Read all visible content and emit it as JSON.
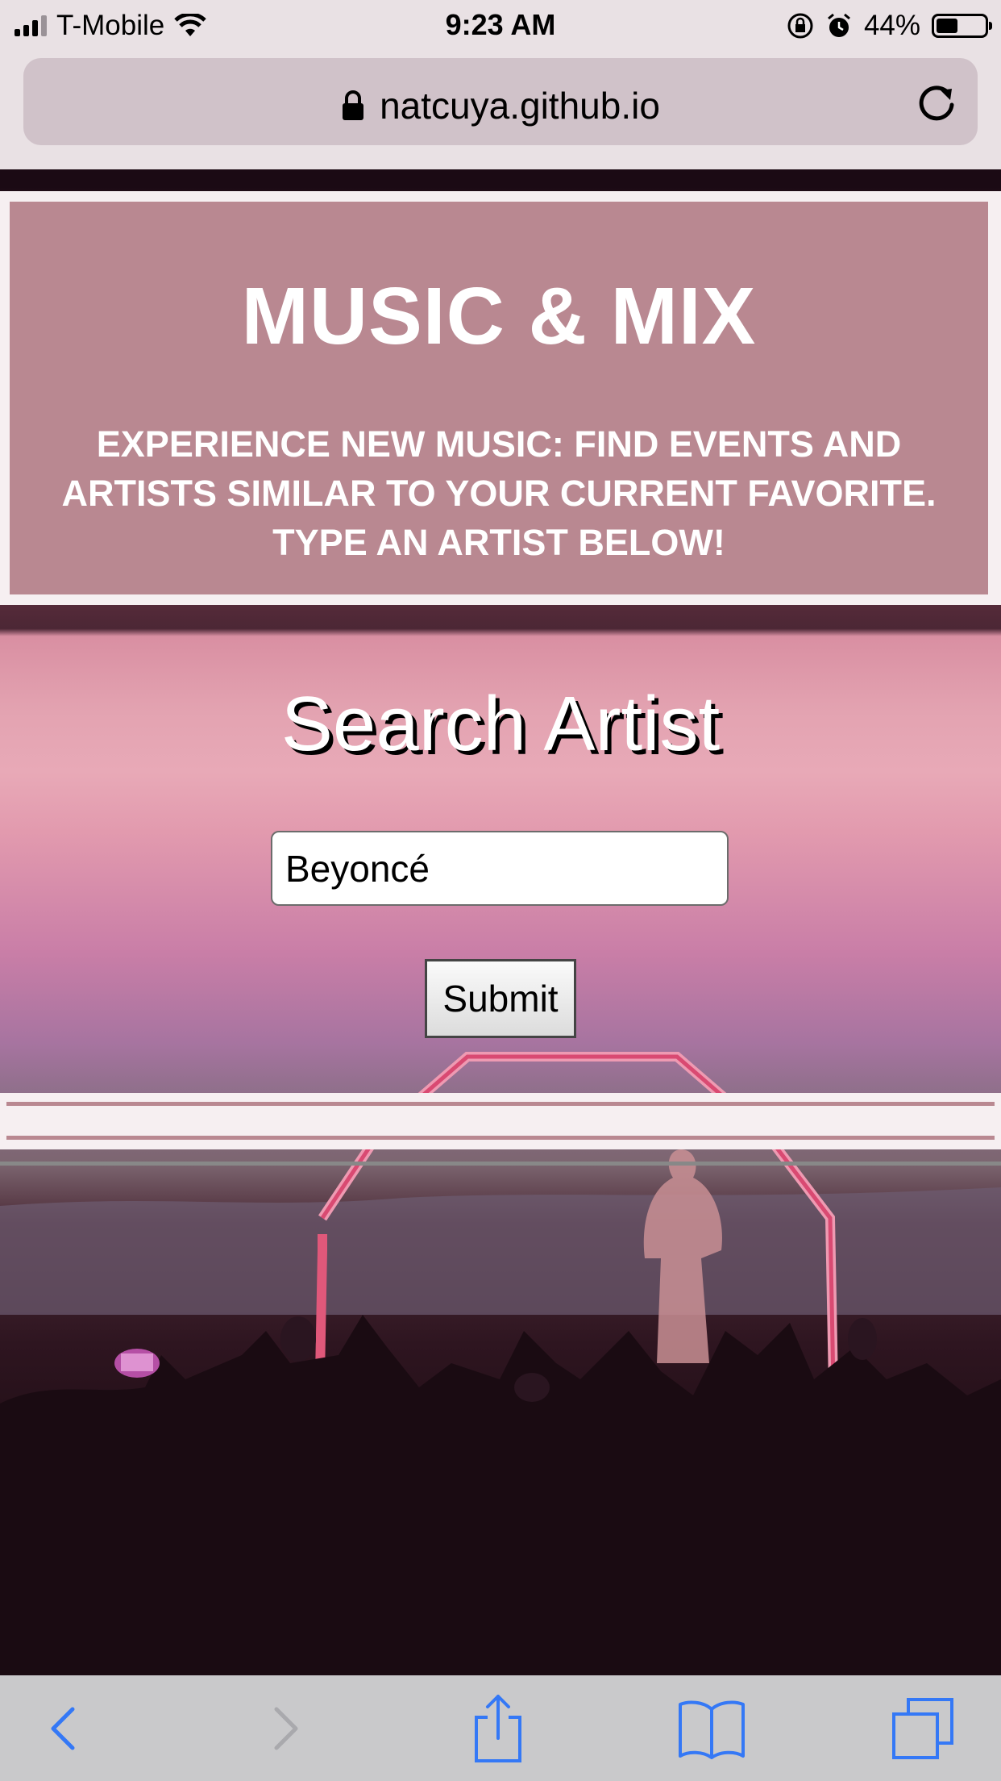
{
  "status_bar": {
    "carrier": "T-Mobile",
    "time": "9:23 AM",
    "battery_percent": "44%",
    "battery_level": 0.44,
    "icons": [
      "signal-icon",
      "wifi-icon",
      "orientation-lock-icon",
      "alarm-icon",
      "battery-icon"
    ]
  },
  "browser": {
    "url": "natcuya.github.io",
    "icons": [
      "lock-icon",
      "reload-icon"
    ]
  },
  "hero": {
    "title": "MUSIC & MIX",
    "description": "EXPERIENCE NEW MUSIC: FIND EVENTS AND ARTISTS SIMILAR TO YOUR CURRENT FAVORITE. TYPE AN ARTIST BELOW!"
  },
  "search": {
    "heading": "Search Artist",
    "input_value": "Beyoncé",
    "submit_label": "Submit"
  },
  "toolbar": {
    "items": [
      "back-icon",
      "forward-icon",
      "share-icon",
      "bookmarks-icon",
      "tabs-icon"
    ],
    "forward_enabled": false
  },
  "colors": {
    "hero_background": "#b98891",
    "hero_border": "#f6eff1",
    "accent": "#e3a3b1",
    "toolbar_tint": "#3478f6"
  }
}
